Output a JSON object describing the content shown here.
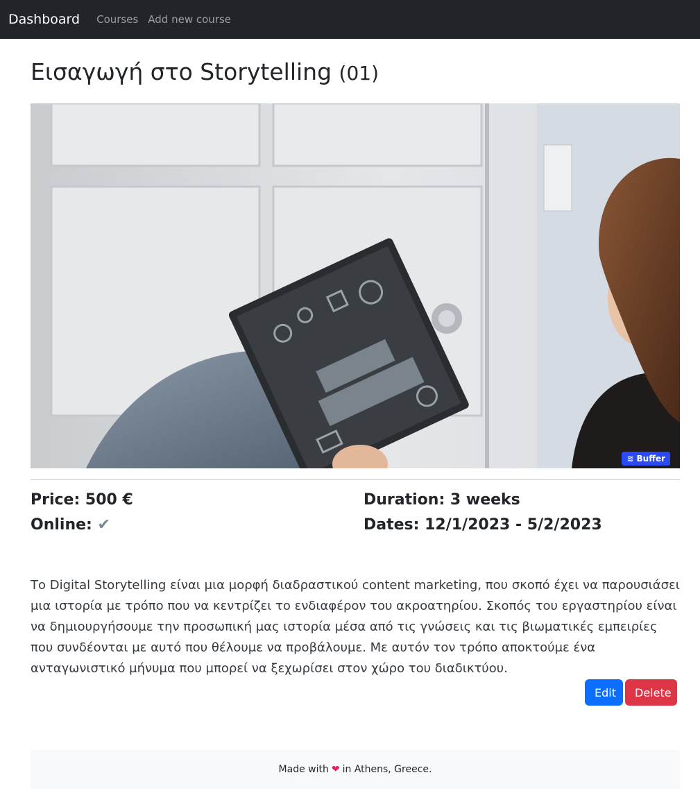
{
  "navbar": {
    "brand": "Dashboard",
    "links": [
      "Courses",
      "Add new course"
    ]
  },
  "course": {
    "title": "Εισαγωγή στο Storytelling",
    "code": "(01)",
    "image_badge": "Buffer",
    "price": "Price: 500 €",
    "online_label": "Online:",
    "online_check": "✔",
    "duration": "Duration: 3 weeks",
    "dates": "Dates: 12/1/2023 - 5/2/2023",
    "description": "Το Digital Storytelling είναι μια μορφή διαδραστικού content marketing, που σκοπό έχει να παρουσιάσει μια ιστορία με τρόπο που να κεντρίζει το ενδιαφέρον του ακροατηρίου. Σκοπός του εργαστηρίου είναι να δημιουργήσουμε την προσωπική μας ιστορία μέσα από τις γνώσεις και τις βιωματικές εμπειρίες που συνδέονται με αυτό που θέλουμε να προβάλουμε. Με αυτόν τον τρόπο αποκτούμε ένα ανταγωνιστικό μήνυμα που μπορεί να ξεχωρίσει στον χώρο του διαδικτύου."
  },
  "actions": {
    "edit": "Edit",
    "delete": "Delete"
  },
  "footer": {
    "prefix": "Made with",
    "heart": "❤",
    "suffix": "in Athens, Greece."
  },
  "colors": {
    "navbar_bg": "#212529",
    "edit_button": "#0d6efd",
    "delete_button": "#dc3545",
    "buffer_badge": "#2b49f5"
  }
}
